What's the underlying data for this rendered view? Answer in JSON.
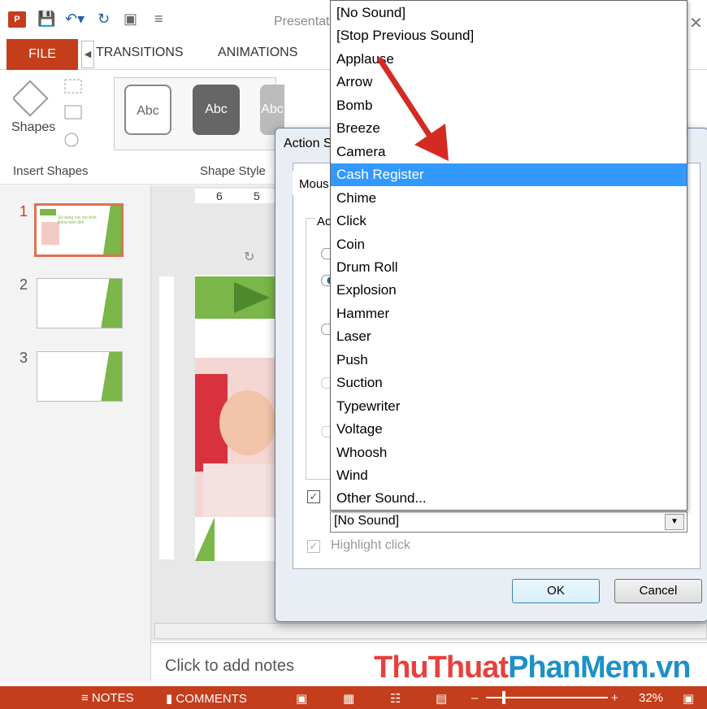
{
  "window": {
    "title": "Presentat",
    "file_tab": "FILE"
  },
  "tabs": [
    "TRANSITIONS",
    "ANIMATIONS"
  ],
  "ribbon": {
    "shapes_label": "Shapes",
    "insert_shapes_label": "Insert Shapes",
    "shape_styles_label": "Shape Style",
    "abc": [
      "Abc",
      "Abc",
      "Abc"
    ]
  },
  "ruler": {
    "top": [
      "6",
      "5"
    ]
  },
  "thumbnails": [
    {
      "number": "1",
      "caption": "Sử dụng các nút lệnh Đồng biến đến"
    },
    {
      "number": "2"
    },
    {
      "number": "3"
    }
  ],
  "notes": {
    "placeholder": "Click to add notes"
  },
  "watermark": {
    "part1": "ThuThuat",
    "part2": "PhanMem",
    "part3": ".vn"
  },
  "statusbar": {
    "notes": "NOTES",
    "comments": "COMMENTS",
    "zoom": "32%"
  },
  "dialog": {
    "title": "Action S",
    "tab": "Mous",
    "group_label": "Ac",
    "highlight_click": "Highlight click",
    "ok": "OK",
    "cancel": "Cancel",
    "play_sound_checked": true,
    "highlight_checked": true
  },
  "sound_combo": {
    "value": "[No Sound]"
  },
  "sound_options": [
    "[No Sound]",
    "[Stop Previous Sound]",
    "Applause",
    "Arrow",
    "Bomb",
    "Breeze",
    "Camera",
    "Cash Register",
    "Chime",
    "Click",
    "Coin",
    "Drum Roll",
    "Explosion",
    "Hammer",
    "Laser",
    "Push",
    "Suction",
    "Typewriter",
    "Voltage",
    "Whoosh",
    "Wind",
    "Other Sound..."
  ],
  "selected_option": "Cash Register",
  "colors": {
    "accent": "#c43e1c",
    "selection": "#3399ff",
    "slide_green": "#7ab648"
  }
}
